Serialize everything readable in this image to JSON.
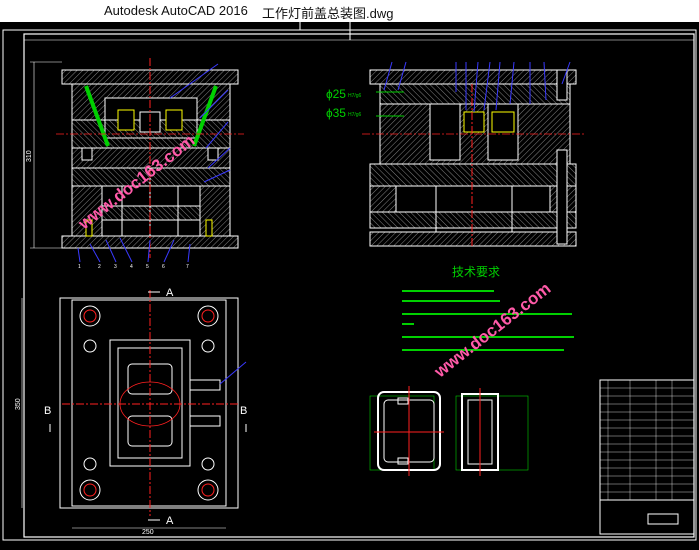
{
  "window": {
    "app_title": "Autodesk AutoCAD 2016",
    "document_title": "工作灯前盖总装图.dwg"
  },
  "drawing": {
    "dimensions": {
      "front_height": "310",
      "plan_height": "350",
      "plan_width": "250",
      "insert_outer": "ɸ25",
      "insert_inner": "ɸ35",
      "fit_tolerance": "H7/g6"
    },
    "section_labels": {
      "section_a_top": "A",
      "section_a_bottom": "A",
      "section_b_left": "B",
      "section_b_right": "B"
    },
    "part_callouts_bottom": [
      "1",
      "2",
      "3",
      "4",
      "5",
      "6",
      "7"
    ],
    "tech_requirements": {
      "heading": "技术要求"
    },
    "watermark": "www.doc163.com"
  },
  "colors": {
    "background": "#000000",
    "line_white": "#ffffff",
    "line_red": "#ff2020",
    "hatch_green": "#00d000",
    "leader_blue": "#3a3aff",
    "accent_yellow": "#ffff00",
    "watermark_pink": "#ff5aa8"
  }
}
